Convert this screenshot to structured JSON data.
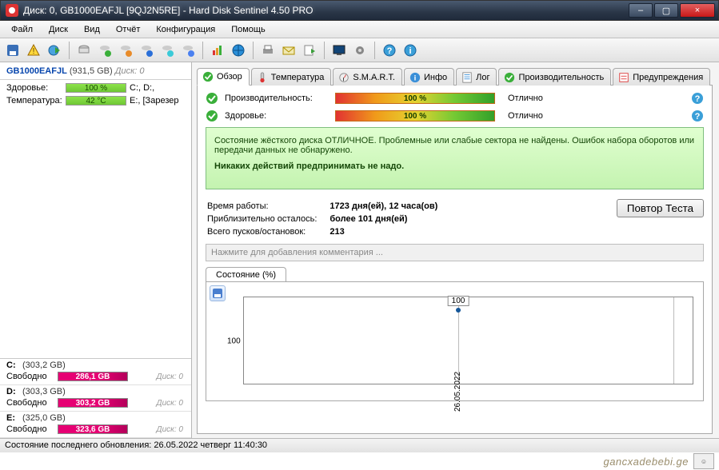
{
  "window": {
    "title": "Диск: 0, GB1000EAFJL [9QJ2N5RE]  -  Hard Disk Sentinel 4.50 PRO",
    "min_icon": "–",
    "max_icon": "▢",
    "close_icon": "×"
  },
  "menu": {
    "items": [
      "Файл",
      "Диск",
      "Вид",
      "Отчёт",
      "Конфигурация",
      "Помощь"
    ]
  },
  "toolbar": {
    "groups": [
      [
        "save-icon",
        "warning-icon",
        "globe-icon"
      ],
      [
        "disk-gray-icon",
        "disk-green-icon",
        "disk-orange-icon",
        "disk-blue-icon",
        "disk-cyan-icon",
        "disk-blue2-icon"
      ],
      [
        "bars-icon",
        "globe2-icon"
      ],
      [
        "printer-icon",
        "mail-icon",
        "export-icon"
      ],
      [
        "screen-icon",
        "gear-icon"
      ],
      [
        "help-icon",
        "info-icon"
      ]
    ]
  },
  "sidebar": {
    "header": {
      "name": "GB1000EAFJL",
      "size": "(931,5 GB)",
      "disk_num": "Диск: 0"
    },
    "stats": {
      "health_label": "Здоровье:",
      "health_value": "100 %",
      "health_drives": "C:, D:,",
      "temp_label": "Температура:",
      "temp_value": "42 °C",
      "temp_drives": "E:, [Зарезер"
    },
    "drives": [
      {
        "letter": "C:",
        "capacity": "(303,2 GB)",
        "free_label": "Свободно",
        "free": "286,1 GB",
        "disk_idx": "Диск: 0"
      },
      {
        "letter": "D:",
        "capacity": "(303,3 GB)",
        "free_label": "Свободно",
        "free": "303,2 GB",
        "disk_idx": "Диск: 0"
      },
      {
        "letter": "E:",
        "capacity": "(325,0 GB)",
        "free_label": "Свободно",
        "free": "323,6 GB",
        "disk_idx": "Диск: 0"
      }
    ]
  },
  "tabs": [
    {
      "icon": "check-icon",
      "label": "Обзор",
      "active": true
    },
    {
      "icon": "thermo-icon",
      "label": "Температура"
    },
    {
      "icon": "smart-icon",
      "label": "S.M.A.R.T."
    },
    {
      "icon": "info-icon",
      "label": "Инфо"
    },
    {
      "icon": "log-icon",
      "label": "Лог"
    },
    {
      "icon": "perf-icon",
      "label": "Производительность"
    },
    {
      "icon": "warn-icon",
      "label": "Предупреждения"
    }
  ],
  "overview": {
    "perf_label": "Производительность:",
    "perf_value": "100 %",
    "perf_rating": "Отлично",
    "health_label": "Здоровье:",
    "health_value": "100 %",
    "health_rating": "Отлично",
    "status_line1": "Состояние жёсткого диска ОТЛИЧНОЕ. Проблемные или слабые сектора не найдены. Ошибок набора оборотов или передачи данных не обнаружено.",
    "status_line2": "Никаких действий предпринимать не надо.",
    "info": {
      "runtime_label": "Время работы:",
      "runtime_value": "1723 дня(ей), 12 часа(ов)",
      "remaining_label": "Приблизительно осталось:",
      "remaining_value": "более 101 дня(ей)",
      "starts_label": "Всего пусков/остановок:",
      "starts_value": "213"
    },
    "repeat_btn": "Повтор Теста",
    "comment_placeholder": "Нажмите для добавления комментария ...",
    "chart_tab": "Состояние (%)"
  },
  "chart_data": {
    "type": "line",
    "xlabel": "",
    "ylabel": "",
    "ylim": [
      0,
      100
    ],
    "yticks": [
      100
    ],
    "categories": [
      "26.05.2022"
    ],
    "series": [
      {
        "name": "Состояние",
        "values": [
          100
        ]
      }
    ],
    "point_label": "100"
  },
  "statusbar": {
    "text": "Состояние последнего обновления: 26.05.2022 четверг 11:40:30"
  },
  "watermark": {
    "text": "gancxadebebi.ge"
  }
}
